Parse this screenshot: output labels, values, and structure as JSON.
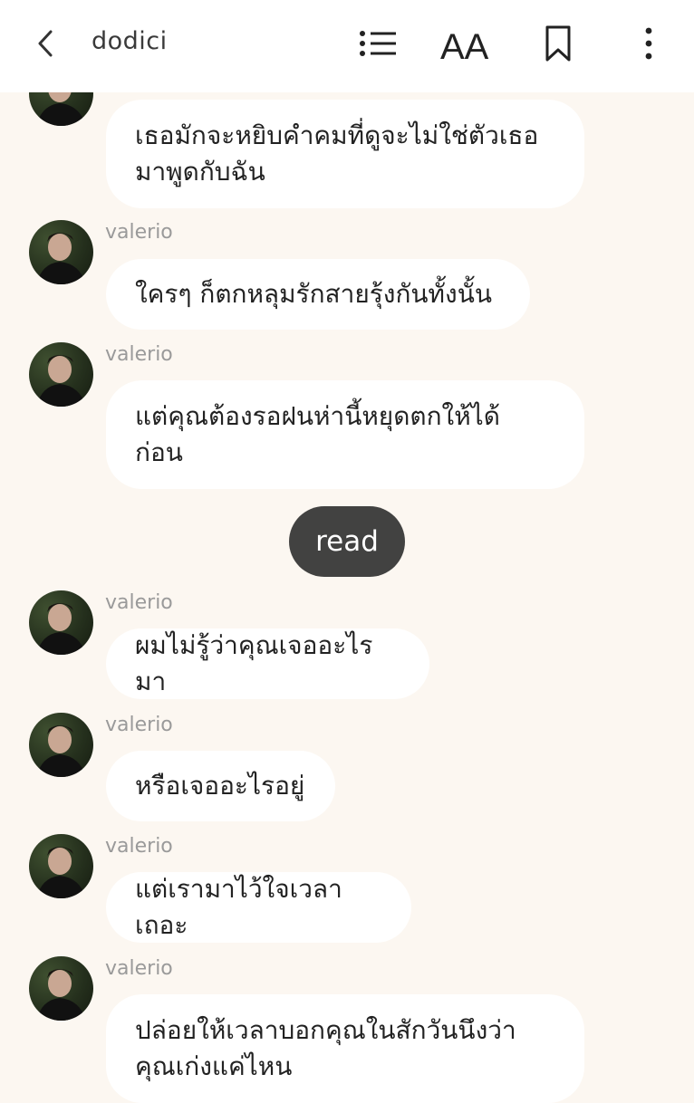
{
  "header": {
    "title": "dodici",
    "icons": {
      "back": "chevron-left-icon",
      "list": "list-icon",
      "font": "font-size-icon",
      "font_label": "AA",
      "bookmark": "bookmark-icon",
      "more": "more-vertical-icon"
    }
  },
  "colors": {
    "background": "#fcf7f1",
    "header": "#ffffff",
    "bubble": "#ffffff",
    "read_pill": "#424241",
    "sender_text": "#9a9a9a"
  },
  "messages": [
    {
      "sender": "",
      "text": "เธอมักจะหยิบคำคมที่ดูจะไม่ใช่ตัวเธอ\nมาพูดกับฉัน"
    },
    {
      "sender": "valerio",
      "text": "ใครๆ ก็ตกหลุมรักสายรุ้งกันทั้งนั้น"
    },
    {
      "sender": "valerio",
      "text": "แต่คุณต้องรอฝนห่านี้หยุดตกให้ได้\nก่อน"
    },
    {
      "sender": "valerio",
      "text": "ผมไม่รู้ว่าคุณเจออะไรมา"
    },
    {
      "sender": "valerio",
      "text": "หรือเจออะไรอยู่"
    },
    {
      "sender": "valerio",
      "text": "แต่เรามาไว้ใจเวลาเถอะ"
    },
    {
      "sender": "valerio",
      "text": "ปล่อยให้เวลาบอกคุณในสักวันนึงว่า\nคุณเก่งแค่ไหน"
    }
  ],
  "read_button": {
    "label": "read"
  }
}
